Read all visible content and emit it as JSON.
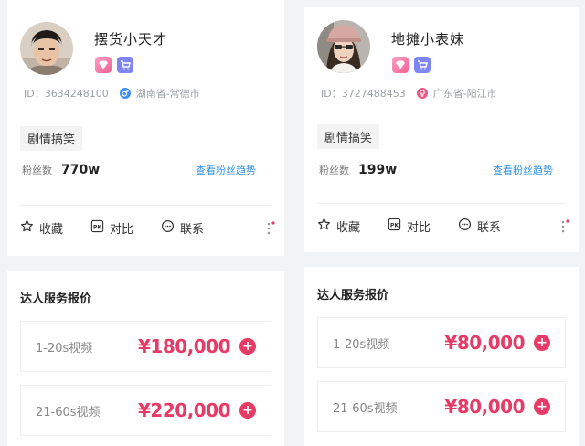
{
  "profiles": [
    {
      "name": "摆货小天才",
      "id_text": "ID：3634248100",
      "location": "湖南省-常德市",
      "category_tag": "剧情搞笑",
      "fans_label": "粉丝数",
      "fans_value": "770w",
      "fans_trend_link": "查看粉丝趋势",
      "gender_icon": "male-icon",
      "gender_color": "#3d8ff5",
      "actions": {
        "favorite": "收藏",
        "compare": "对比",
        "contact": "联系"
      },
      "price_title": "达人服务报价",
      "prices": [
        {
          "label": "1-20s视频",
          "value": "¥180,000"
        },
        {
          "label": "21-60s视频",
          "value": "¥220,000"
        }
      ]
    },
    {
      "name": "地摊小表妹",
      "id_text": "ID：3727488453",
      "location": "广东省-阳江市",
      "category_tag": "剧情搞笑",
      "fans_label": "粉丝数",
      "fans_value": "199w",
      "fans_trend_link": "查看粉丝趋势",
      "gender_icon": "female-icon",
      "gender_color": "#f0567e",
      "actions": {
        "favorite": "收藏",
        "compare": "对比",
        "contact": "联系"
      },
      "price_title": "达人服务报价",
      "prices": [
        {
          "label": "1-20s视频",
          "value": "¥80,000"
        },
        {
          "label": "21-60s视频",
          "value": "¥80,000"
        }
      ]
    }
  ],
  "colors": {
    "accent_pink": "#e83a66",
    "link_blue": "#2f8fe0",
    "badge_cart": "#7e86f5",
    "badge_diamond": "#f06292"
  },
  "icons": [
    "diamond-badge-icon",
    "cart-badge-icon",
    "star-icon",
    "pk-icon",
    "chat-icon",
    "more-dots-icon",
    "plus-icon"
  ]
}
